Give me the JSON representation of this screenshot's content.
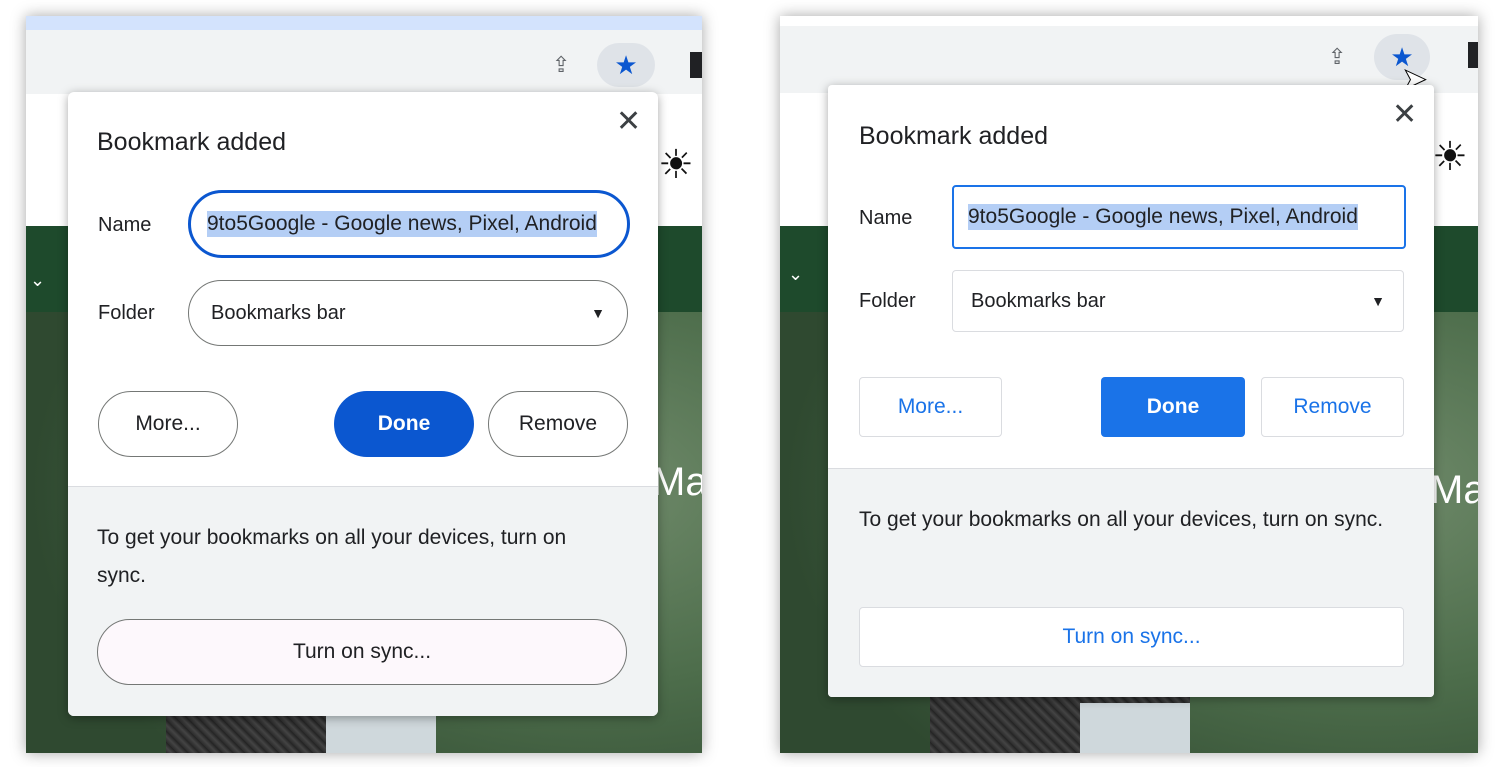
{
  "left": {
    "dialog": {
      "title": "Bookmark added",
      "close_symbol": "✕",
      "name_label": "Name",
      "name_value": "9to5Google - Google news, Pixel, Android",
      "folder_label": "Folder",
      "folder_value": "Bookmarks bar",
      "more_label": "More...",
      "done_label": "Done",
      "remove_label": "Remove",
      "sync_message": "To get your bookmarks on all your devices, turn on sync.",
      "sync_button_label": "Turn on sync..."
    },
    "page_text": "Mat"
  },
  "right": {
    "dialog": {
      "title": "Bookmark added",
      "close_symbol": "✕",
      "name_label": "Name",
      "name_value": "9to5Google - Google news, Pixel, Android",
      "folder_label": "Folder",
      "folder_value": "Bookmarks bar",
      "more_label": "More...",
      "done_label": "Done",
      "remove_label": "Remove",
      "sync_message": "To get your bookmarks on all your devices, turn on sync.",
      "sync_button_label": "Turn on sync..."
    },
    "page_text": "Mat"
  },
  "icons": {
    "share": "share-icon",
    "star": "bookmark-star-icon",
    "brightness": "brightness-icon",
    "chevron": "chevron-down-icon"
  },
  "colors": {
    "left_accent": "#0b57d0",
    "right_accent": "#1a73e8",
    "selection": "#b4cef5",
    "footer_bg": "#f1f3f4"
  }
}
